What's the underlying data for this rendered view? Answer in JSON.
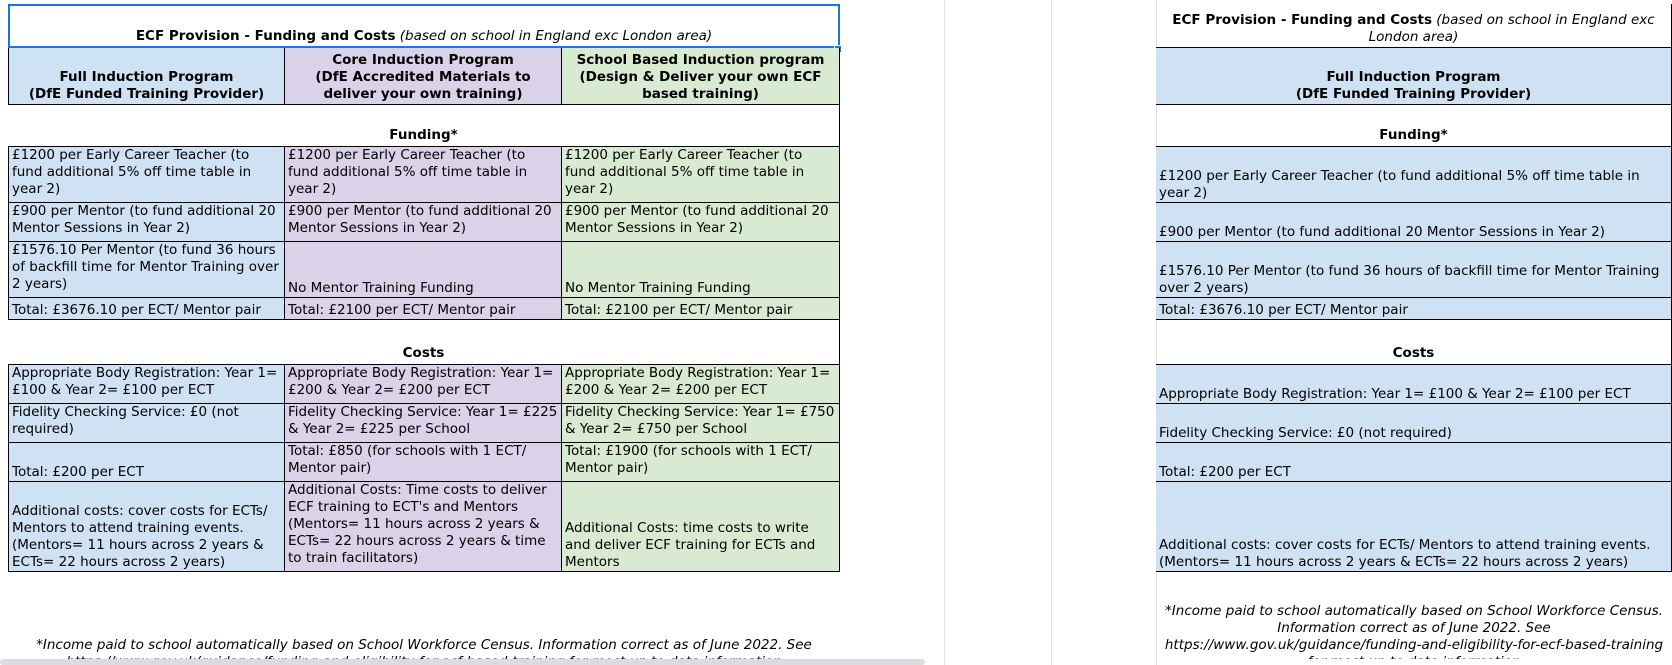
{
  "left": {
    "title_bold": "ECF Provision - Funding and Costs",
    "title_italic": " (based on school in England exc London area)",
    "headers": [
      "Full Induction Program\n(DfE Funded Training Provider)",
      "Core Induction Program\n(DfE Accredited Materials to deliver your own training)",
      "School Based Induction program\n(Design & Deliver your own ECF based training)"
    ],
    "funding_heading": "Funding*",
    "funding_rows": [
      [
        "£1200 per Early Career Teacher (to fund additional 5% off time table in year 2)",
        "£1200 per Early Career Teacher (to fund additional 5% off time table in year 2)",
        "£1200 per Early Career Teacher (to fund additional 5% off time table in year 2)"
      ],
      [
        "£900 per Mentor (to fund additional 20 Mentor Sessions in Year 2)",
        "£900 per Mentor (to fund additional 20 Mentor Sessions in Year 2)",
        "£900 per Mentor (to fund additional 20 Mentor Sessions in Year 2)"
      ],
      [
        "£1576.10 Per Mentor (to fund 36 hours of backfill time for Mentor Training over 2 years)",
        "No Mentor Training Funding",
        "No Mentor Training Funding"
      ],
      [
        "Total: £3676.10 per ECT/ Mentor pair",
        "Total: £2100 per ECT/ Mentor pair",
        "Total: £2100 per ECT/ Mentor pair"
      ]
    ],
    "costs_heading": "Costs",
    "costs_rows": [
      [
        "Appropriate Body Registration: Year 1= £100 & Year 2= £100 per ECT",
        "Appropriate Body Registration: Year 1= £200 & Year 2= £200 per ECT",
        "Appropriate Body Registration: Year 1= £200 & Year 2= £200 per ECT"
      ],
      [
        "Fidelity Checking Service: £0 (not required)",
        "Fidelity Checking Service: Year 1= £225 & Year 2= £225 per School",
        "Fidelity Checking Service: Year 1= £750 & Year 2= £750 per School"
      ],
      [
        "Total: £200 per ECT",
        "Total: £850 (for schools with 1 ECT/ Mentor pair)",
        "Total: £1900 (for schools with 1 ECT/ Mentor pair)"
      ],
      [
        "Additional costs: cover costs for ECTs/ Mentors to attend training events. (Mentors= 11 hours across 2 years & ECTs= 22 hours across 2 years)",
        "Additional Costs: Time costs to deliver ECF training to ECT's and Mentors (Mentors= 11 hours across 2 years & ECTs= 22 hours across 2 years & time to train facilitators)",
        "Additional Costs: time costs to write and deliver ECF training for ECTs and Mentors"
      ]
    ],
    "footnote": "*Income paid to school automatically based on School Workforce Census. Information correct as of June 2022. See https://www.gov.uk/guidance/funding-and-eligibility-for-ecf-based-training for most up to date information"
  },
  "right": {
    "title_bold": "ECF Provision - Funding and Costs",
    "title_italic": " (based on school in England exc London area)",
    "header": "Full Induction Program\n(DfE Funded Training Provider)",
    "funding_heading": "Funding*",
    "funding_rows": [
      "£1200 per Early Career Teacher (to fund additional 5% off time table in year 2)",
      "£900 per Mentor (to fund additional 20 Mentor Sessions in Year 2)",
      "£1576.10 Per Mentor (to fund 36 hours of backfill time for Mentor Training over 2 years)",
      "Total: £3676.10 per ECT/ Mentor pair"
    ],
    "costs_heading": "Costs",
    "costs_rows": [
      "Appropriate Body Registration: Year 1= £100 & Year 2= £100 per ECT",
      "Fidelity Checking Service: £0 (not required)",
      "Total: £200 per ECT",
      "Additional costs: cover costs for ECTs/ Mentors to attend training events. (Mentors= 11 hours across 2 years & ECTs= 22 hours across 2 years)"
    ],
    "footnote": "*Income paid to school automatically based on School Workforce Census. Information correct as of June 2022. See https://www.gov.uk/guidance/funding-and-eligibility-for-ecf-based-training for most up to date information"
  }
}
